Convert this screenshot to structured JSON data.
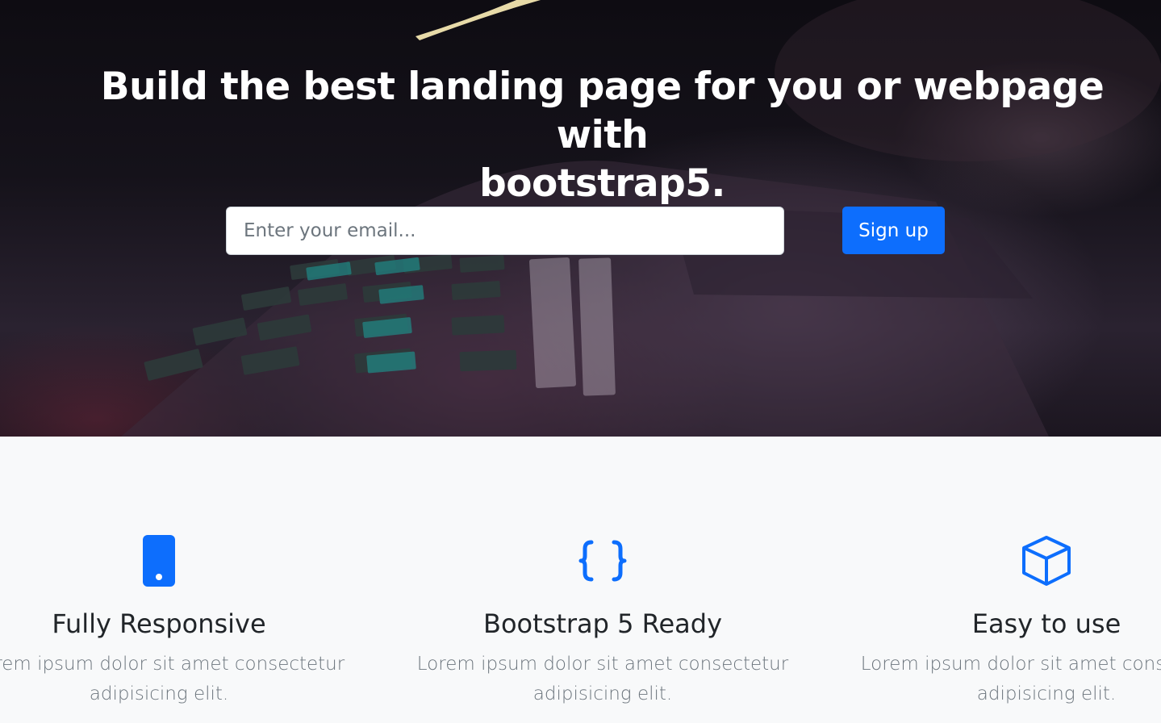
{
  "hero": {
    "title_line1": "Build the best landing page for you or webpage with",
    "title_line2": "bootstrap5.",
    "email_placeholder": "Enter your email...",
    "signup_label": "Sign up"
  },
  "features": [
    {
      "icon": "phone-icon",
      "title": "Fully Responsive",
      "desc_line1": "Lorem ipsum dolor sit amet consectetur",
      "desc_line2": "adipisicing elit."
    },
    {
      "icon": "braces-icon",
      "title": "Bootstrap 5 Ready",
      "desc_line1": "Lorem ipsum dolor sit amet consectetur",
      "desc_line2": "adipisicing elit."
    },
    {
      "icon": "box-icon",
      "title": "Easy to use",
      "desc_line1": "Lorem ipsum dolor sit amet consectetur",
      "desc_line2": "adipisicing elit."
    }
  ],
  "colors": {
    "primary": "#0d6efd",
    "heading_text": "#212529",
    "muted_text": "#6c757d",
    "section_bg": "#f8f9fa"
  }
}
